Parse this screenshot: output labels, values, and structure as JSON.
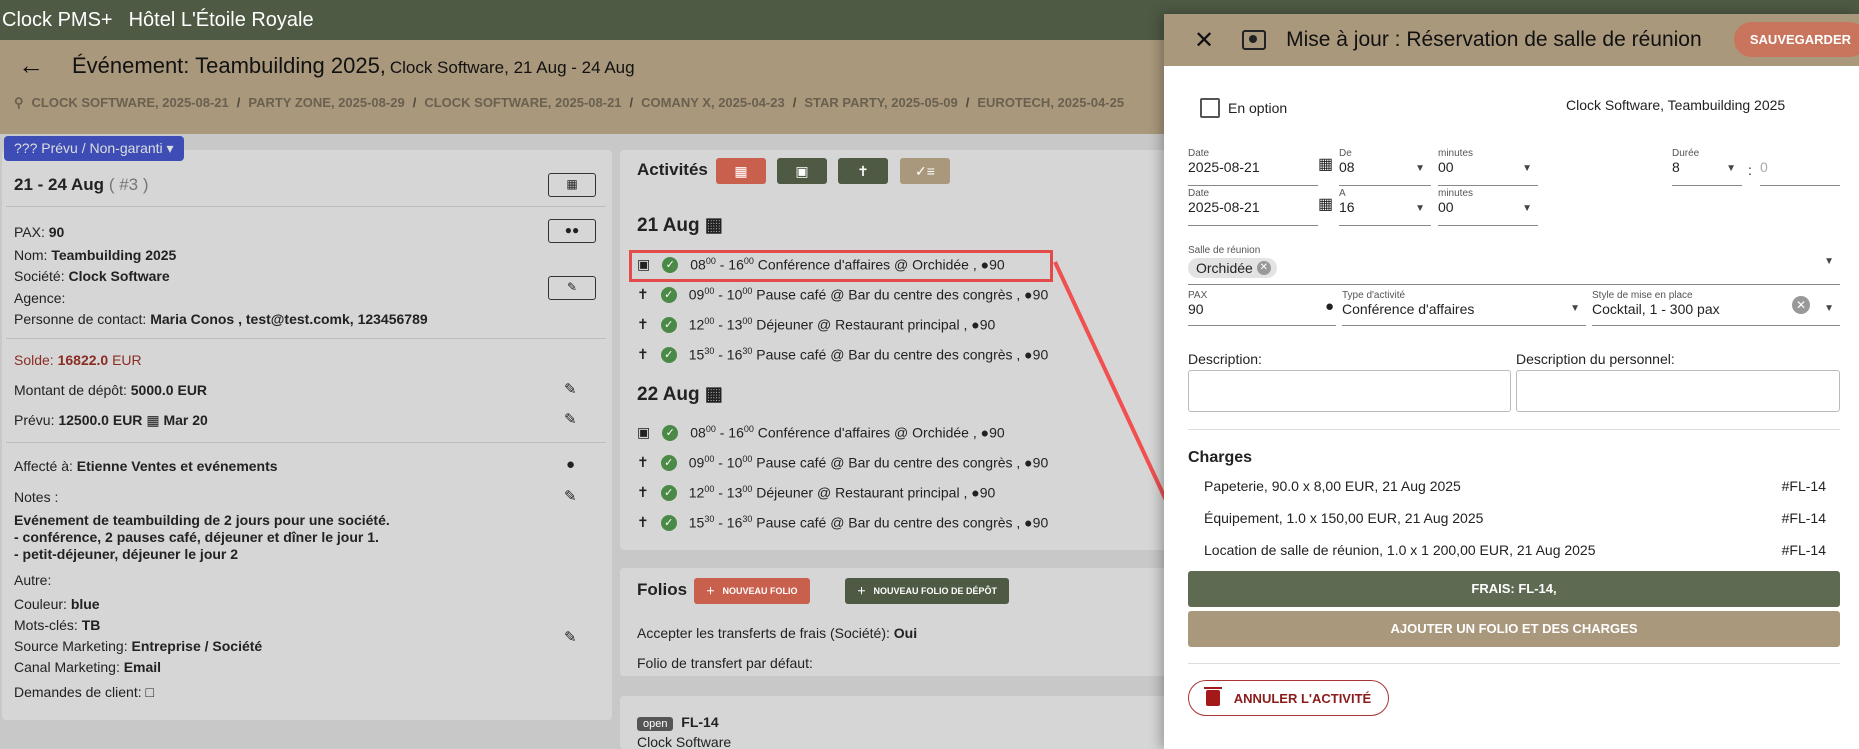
{
  "app": {
    "name": "Clock PMS+",
    "hotel": "Hôtel L'Étoile Royale"
  },
  "event": {
    "title": "Événement: Teambuilding 2025,",
    "subtitle": "Clock Software, 21 Aug - 24 Aug"
  },
  "breadcrumbs": [
    "CLOCK SOFTWARE, 2025-08-21",
    "PARTY ZONE, 2025-08-29",
    "CLOCK SOFTWARE, 2025-08-21",
    "COMANY X, 2025-04-23",
    "STAR PARTY, 2025-05-09",
    "EUROTECH, 2025-04-25"
  ],
  "left": {
    "status": "??? Prévu / Non-garanti",
    "dates": "21 - 24 Aug",
    "count": "( #3 )",
    "pax_label": "PAX:",
    "pax": "90",
    "name_label": "Nom:",
    "name": "Teambuilding 2025",
    "company_label": "Société:",
    "company": "Clock Software",
    "agency_label": "Agence:",
    "contact_label": "Personne de contact:",
    "contact": "Maria Conos , test@test.comk, 123456789",
    "balance_label": "Solde:",
    "balance": "16822.0",
    "balance_unit": "EUR",
    "deposit_label": "Montant de dépôt:",
    "deposit": "5000.0 EUR",
    "planned_label": "Prévu:",
    "planned": "12500.0 EUR",
    "planned_date": "Mar 20",
    "assigned_label": "Affecté à:",
    "assigned": "Etienne  Ventes et evénements",
    "notes_label": "Notes :",
    "notes_1": "Evénement de teambuilding de 2 jours pour une société.",
    "notes_2": "- conférence, 2 pauses café, déjeuner et dîner le jour 1.",
    "notes_3": "- petit-déjeuner, déjeuner le jour 2",
    "other_label": "Autre:",
    "color_label": "Couleur:",
    "color": "blue",
    "keywords_label": "Mots-clés:",
    "keywords": "TB",
    "source_label": "Source Marketing:",
    "source": "Entreprise / Société",
    "channel_label": "Canal Marketing:",
    "channel": "Email",
    "requests_label": "Demandes de client:"
  },
  "activities": {
    "title": "Activités",
    "days": [
      {
        "date": "21 Aug",
        "items": [
          {
            "h1": "08",
            "m1": "00",
            "h2": "16",
            "m2": "00",
            "text": "Conférence d'affaires @ Orchidée ,",
            "pax": "90",
            "icon": "room-icon"
          },
          {
            "h1": "09",
            "m1": "00",
            "h2": "10",
            "m2": "00",
            "text": "Pause café @ Bar du centre des congrès ,",
            "pax": "90",
            "icon": "food-icon"
          },
          {
            "h1": "12",
            "m1": "00",
            "h2": "13",
            "m2": "00",
            "text": "Déjeuner @ Restaurant principal ,",
            "pax": "90",
            "icon": "food-icon"
          },
          {
            "h1": "15",
            "m1": "30",
            "h2": "16",
            "m2": "30",
            "text": "Pause café @ Bar du centre des congrès ,",
            "pax": "90",
            "icon": "food-icon"
          }
        ]
      },
      {
        "date": "22 Aug",
        "items": [
          {
            "h1": "08",
            "m1": "00",
            "h2": "16",
            "m2": "00",
            "text": "Conférence d'affaires @ Orchidée ,",
            "pax": "90",
            "icon": "room-icon"
          },
          {
            "h1": "09",
            "m1": "00",
            "h2": "10",
            "m2": "00",
            "text": "Pause café @ Bar du centre des congrès ,",
            "pax": "90",
            "icon": "food-icon"
          },
          {
            "h1": "12",
            "m1": "00",
            "h2": "13",
            "m2": "00",
            "text": "Déjeuner @ Restaurant principal ,",
            "pax": "90",
            "icon": "food-icon"
          },
          {
            "h1": "15",
            "m1": "30",
            "h2": "16",
            "m2": "30",
            "text": "Pause café @ Bar du centre des congrès ,",
            "pax": "90",
            "icon": "food-icon"
          }
        ]
      }
    ]
  },
  "folios": {
    "title": "Folios",
    "new_folio": "NOUVEAU FOLIO",
    "new_deposit_folio": "NOUVEAU FOLIO DE DÉPÔT",
    "accept_label": "Accepter les transferts de frais (Société):",
    "accept": "Oui",
    "default_label": "Folio de transfert par défaut:",
    "badge": "open",
    "folio_id": "FL-14",
    "folio_owner": "Clock Software"
  },
  "dialog": {
    "title": "Mise à jour : Réservation de salle de réunion",
    "save": "SAUVEGARDER",
    "option_label": "En option",
    "context": "Clock Software, Teambuilding 2025",
    "from": {
      "date_label": "Date",
      "date": "2025-08-21",
      "hour_label": "De",
      "hour": "08",
      "min_label": "minutes",
      "min": "00"
    },
    "to": {
      "date_label": "Date",
      "date": "2025-08-21",
      "hour_label": "A",
      "hour": "16",
      "min_label": "minutes",
      "min": "00"
    },
    "duration_label": "Durée",
    "duration_h": "8",
    "duration_sep": ":",
    "duration_m_placeholder": "0",
    "room_label": "Salle de réunion",
    "room": "Orchidée",
    "pax_label": "PAX",
    "pax": "90",
    "type_label": "Type d'activité",
    "type": "Conférence d'affaires",
    "style_label": "Style de mise en place",
    "style": "Cocktail, 1 - 300 pax",
    "desc_label": "Description:",
    "staff_desc_label": "Description du personnel:",
    "charges_title": "Charges",
    "charges": [
      {
        "text": "Papeterie, 90.0 x 8,00 EUR, 21 Aug 2025",
        "folio": "#FL-14"
      },
      {
        "text": "Équipement, 1.0 x 150,00 EUR, 21 Aug 2025",
        "folio": "#FL-14"
      },
      {
        "text": "Location de salle de réunion, 1.0 x 1 200,00 EUR, 21 Aug 2025",
        "folio": "#FL-14"
      }
    ],
    "fees_button": "FRAIS: FL-14,",
    "add_folio_button": "AJOUTER UN FOLIO ET DES CHARGES",
    "cancel_activity": "ANNULER L'ACTIVITÉ"
  },
  "colors": {
    "header": "#4e5a44",
    "accent": "#a9987c",
    "save": "#c9745d",
    "red": "#c9604d",
    "green": "#4e5a44"
  }
}
